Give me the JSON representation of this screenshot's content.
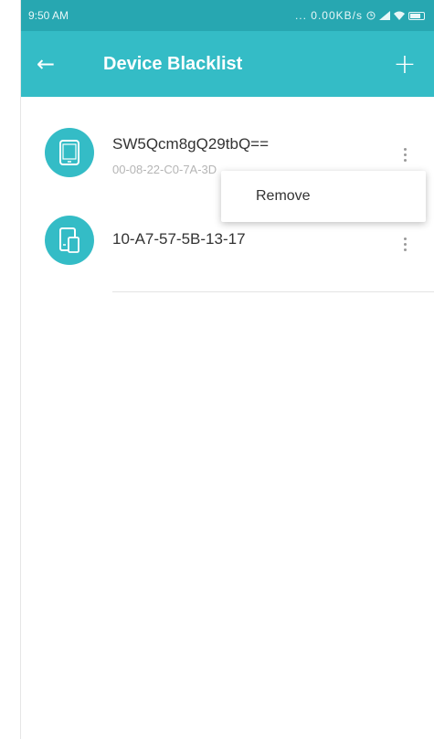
{
  "status_bar": {
    "time": "9:50 AM",
    "indicators": "... 0.00KB/s",
    "icons": [
      "clock-icon",
      "signal-icon",
      "wifi-icon",
      "battery-icon"
    ]
  },
  "app_bar": {
    "title": "Device Blacklist",
    "back_icon": "arrow-left-icon",
    "back_glyph": "←",
    "add_icon": "plus-icon",
    "add_glyph": "+"
  },
  "devices": [
    {
      "name": "SW5Qcm8gQ29tbQ==",
      "mac": "00-08-22-C0-7A-3D",
      "icon": "tablet-icon"
    },
    {
      "name": "10-A7-57-5B-13-17",
      "mac": "",
      "icon": "multi-device-icon"
    }
  ],
  "context_menu": {
    "items": [
      {
        "label": "Remove"
      }
    ]
  },
  "colors": {
    "status_bar": "#27a7b1",
    "primary": "#34bcc6",
    "text": "#333333",
    "subtext": "#b5b5b5"
  }
}
